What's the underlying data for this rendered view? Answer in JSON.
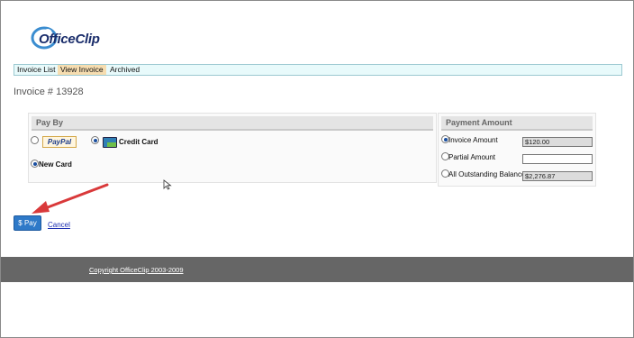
{
  "logo": {
    "text": "OfficeClip"
  },
  "tabs": [
    {
      "label": "Invoice List",
      "active": false
    },
    {
      "label": "View Invoice",
      "active": true
    },
    {
      "label": "Archived",
      "active": false
    }
  ],
  "invoice": {
    "title": "Invoice # 13928"
  },
  "pay_by": {
    "heading": "Pay By",
    "paypal_logo": "PayPal",
    "credit_card_label": "Credit Card",
    "new_card_label": "New Card",
    "selected": "credit_card"
  },
  "payment_amount": {
    "heading": "Payment Amount",
    "options": [
      {
        "label": "Invoice Amount",
        "value": "$120.00",
        "checked": true,
        "editable": false
      },
      {
        "label": "Partial Amount",
        "value": "",
        "checked": false,
        "editable": true
      },
      {
        "label": "All Outstanding Balance",
        "value": "$2,276.87",
        "checked": false,
        "editable": false
      }
    ]
  },
  "actions": {
    "pay_label": "$ Pay",
    "cancel_label": "Cancel"
  },
  "footer": {
    "copyright": "Copyright OfficeClip 2003-2009"
  },
  "colors": {
    "accent": "#2e79c8",
    "arrow": "#d9393a",
    "footer": "#666666",
    "active_tab": "#f6ddb0"
  }
}
